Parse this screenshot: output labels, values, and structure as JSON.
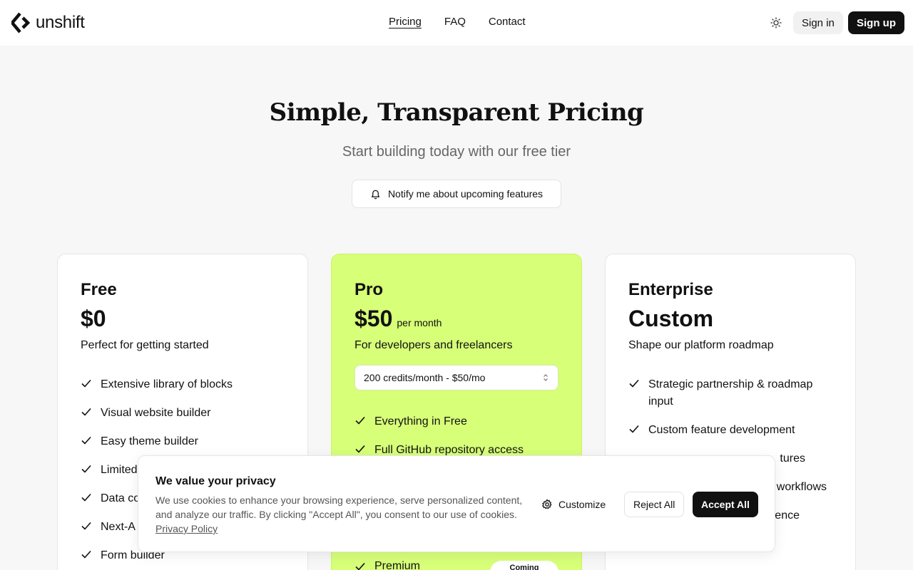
{
  "header": {
    "brand": "unshift",
    "nav": [
      {
        "label": "Pricing",
        "active": true
      },
      {
        "label": "FAQ",
        "active": false
      },
      {
        "label": "Contact",
        "active": false
      }
    ],
    "theme_icon": "sun-icon",
    "signin_label": "Sign in",
    "signup_label": "Sign up"
  },
  "hero": {
    "title": "Simple, Transparent Pricing",
    "subtitle": "Start building today with our free tier",
    "notify_label": "Notify me about upcoming features",
    "notify_icon": "bell-icon"
  },
  "plans": {
    "free": {
      "name": "Free",
      "price": "$0",
      "description": "Perfect for getting started",
      "features": [
        "Extensive library of blocks",
        "Visual website builder",
        "Easy theme builder",
        "Limited",
        "Data co",
        "Next-A",
        "Form builder"
      ]
    },
    "pro": {
      "name": "Pro",
      "price": "$50",
      "period": "per month",
      "description": "For developers and freelancers",
      "select_value": "200 credits/month - $50/mo",
      "features": [
        "Everything in Free",
        "Full GitHub repository access",
        "Premium"
      ],
      "coming_badge": "Coming"
    },
    "enterprise": {
      "name": "Enterprise",
      "price": "Custom",
      "description": "Shape our platform roadmap",
      "features": [
        "Strategic partnership & roadmap input",
        "Custom feature development",
        "tures",
        "workflows",
        "ence"
      ]
    }
  },
  "cookie": {
    "title": "We value your privacy",
    "text": "We use cookies to enhance your browsing experience, serve personalized content, and analyze our traffic. By clicking \"Accept All\", you consent to our use of cookies.",
    "link": "Privacy Policy",
    "customize_label": "Customize",
    "reject_label": "Reject All",
    "accept_label": "Accept All"
  },
  "colors": {
    "accent": "#d7ff78",
    "dark": "#111111",
    "background": "#f7f7f7"
  }
}
